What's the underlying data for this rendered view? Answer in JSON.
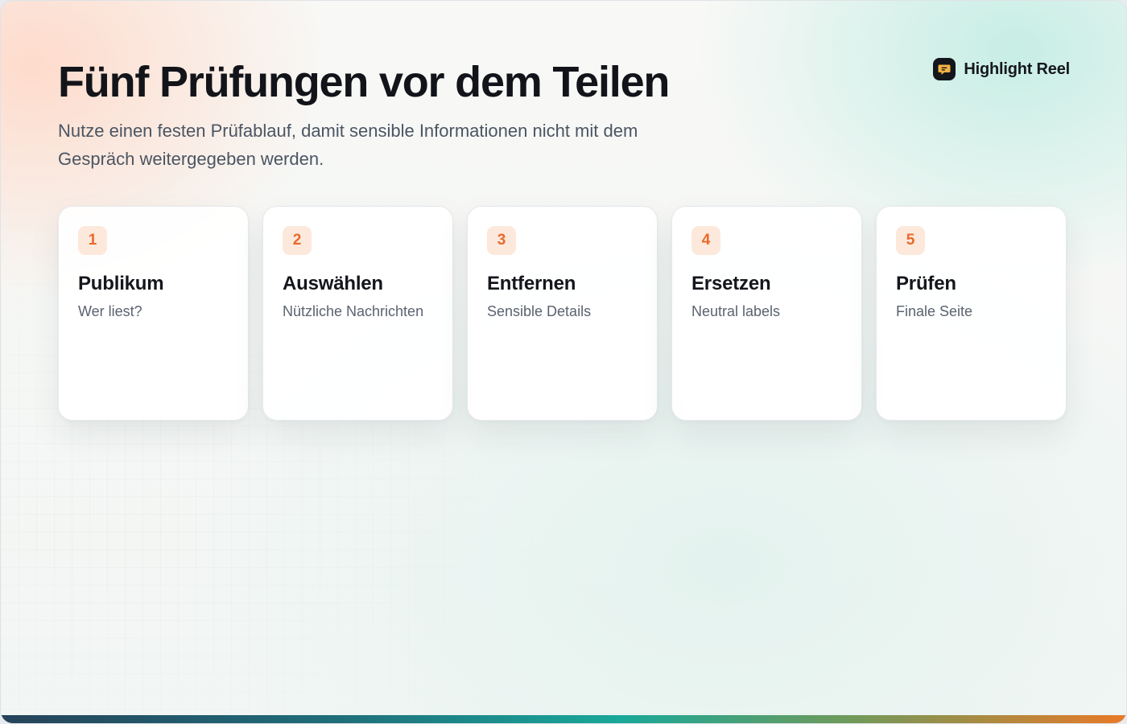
{
  "header": {
    "title": "Fünf Prüfungen vor dem Teilen",
    "subtitle": "Nutze einen festen Prüfablauf, damit sensible Informationen nicht mit dem Gespräch weitergegeben werden."
  },
  "brand": {
    "name": "Highlight Reel",
    "icon": "chat-bubble-icon"
  },
  "steps": [
    {
      "number": "1",
      "title": "Publikum",
      "subtitle": "Wer liest?"
    },
    {
      "number": "2",
      "title": "Auswählen",
      "subtitle": "Nützliche Nachrichten"
    },
    {
      "number": "3",
      "title": "Entfernen",
      "subtitle": "Sensible Details"
    },
    {
      "number": "4",
      "title": "Ersetzen",
      "subtitle": "Neutral labels"
    },
    {
      "number": "5",
      "title": "Prüfen",
      "subtitle": "Finale Seite"
    }
  ],
  "colors": {
    "accent": "#ea6a2c",
    "badge_bg": "#fde8dc",
    "title": "#12141a",
    "brand_logo_bg": "#14161c",
    "brand_logo_fg": "#f5b342"
  }
}
